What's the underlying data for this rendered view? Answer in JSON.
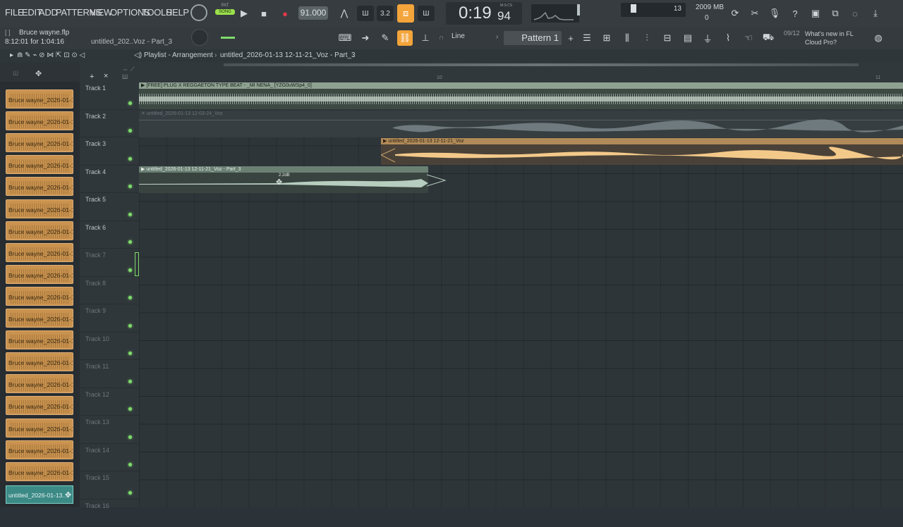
{
  "menu": [
    "FILE",
    "EDIT",
    "ADD",
    "PATTERNS",
    "VIEW",
    "OPTIONS",
    "TOOLS",
    "HELP"
  ],
  "transport": {
    "pat_label": "PAT",
    "song_label": "SONG",
    "tempo": "91.000",
    "time": "0:19",
    "time_ms": "94",
    "time_unit": "M:S:CS"
  },
  "status": {
    "cpu_value": "13",
    "memory": "2009 MB",
    "mem_zero": "0"
  },
  "project": {
    "filename": "Bruce wayne.flp",
    "position": "8:12:01 for 1:04:16",
    "hint": "untitled_202..Voz - Part_3"
  },
  "toolbar": {
    "snap": "Line",
    "pattern": "Pattern 1"
  },
  "news": {
    "date": "09/12",
    "text": "What's new in FL Cloud Pro?"
  },
  "playlist": {
    "breadcrumb": "Playlist - Arrangement",
    "sep": "›",
    "arrangement": "untitled_2026-01-13 12-11-21_Voz - Part_3"
  },
  "browser": {
    "items": [
      "Bruce wayne_2026-01-1...",
      "Bruce wayne_2026-01-1...",
      "Bruce wayne_2026-01-1...",
      "Bruce wayne_2026-01-1...",
      "Bruce wayne_2026-01-1...",
      "Bruce wayne_2026-01-1...",
      "Bruce wayne_2026-01-1...",
      "Bruce wayne_2026-01-1...",
      "Bruce wayne_2026-01-1...",
      "Bruce wayne_2026-01-1...",
      "Bruce wayne_2026-01-1...",
      "Bruce wayne_2026-01-1...",
      "Bruce wayne_2026-01-1...",
      "Bruce wayne_2026-01-1...",
      "Bruce wayne_2026-01-1...",
      "Bruce wayne_2026-01-1...",
      "Bruce wayne_2026-01-1...",
      "Bruce wayne_2026-01-1..."
    ],
    "selected": "untitled_2026-01-13..."
  },
  "tracks": [
    "Track 1",
    "Track 2",
    "Track 3",
    "Track 4",
    "Track 5",
    "Track 6",
    "Track 7",
    "Track 8",
    "Track 9",
    "Track 10",
    "Track 11",
    "Track 12",
    "Track 13",
    "Track 14",
    "Track 15",
    "Track 16"
  ],
  "ruler": {
    "m10": "10",
    "m11": "11"
  },
  "clips": {
    "c1": "[FREE] PLUG X REGGAETON TYPE BEAT - _MI NENA_ [YZG0uWSp4_0]",
    "c2": "untitled_2026-01-13 12-03-24_Voz",
    "c3": "untitled_2026-01-13 12-11-21_Voz",
    "c4": "untitled_2026-01-13 12-11-21_Voz - Part_3",
    "vol": "2.2dB"
  }
}
